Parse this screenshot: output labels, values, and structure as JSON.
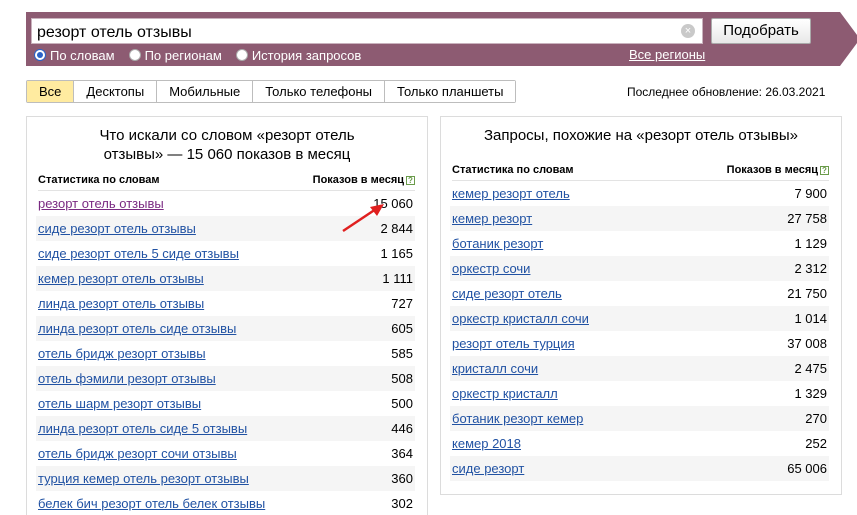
{
  "search": {
    "query": "резорт отель отзывы",
    "clear_glyph": "×",
    "submit_label": "Подобрать"
  },
  "modes": [
    {
      "label": "По словам",
      "selected": true
    },
    {
      "label": "По регионам",
      "selected": false
    },
    {
      "label": "История запросов",
      "selected": false
    }
  ],
  "regions_link": "Все регионы",
  "device_tabs": [
    {
      "label": "Все",
      "active": true
    },
    {
      "label": "Десктопы",
      "active": false
    },
    {
      "label": "Мобильные",
      "active": false
    },
    {
      "label": "Только телефоны",
      "active": false
    },
    {
      "label": "Только планшеты",
      "active": false
    }
  ],
  "last_update": "Последнее обновление: 26.03.2021",
  "left_panel": {
    "title_line1": "Что искали со словом «резорт отель",
    "title_line2": "отзывы» — 15 060 показов в месяц",
    "col_query": "Статистика по словам",
    "col_shows": "Показов в месяц",
    "help_glyph": "?",
    "rows": [
      {
        "query": "резорт отель отзывы",
        "shows": "15 060"
      },
      {
        "query": "сиде резорт отель отзывы",
        "shows": "2 844"
      },
      {
        "query": "сиде резорт отель 5 сиде отзывы",
        "shows": "1 165"
      },
      {
        "query": "кемер резорт отель отзывы",
        "shows": "1 111"
      },
      {
        "query": "линда резорт отель отзывы",
        "shows": "727"
      },
      {
        "query": "линда резорт отель сиде отзывы",
        "shows": "605"
      },
      {
        "query": "отель бридж резорт отзывы",
        "shows": "585"
      },
      {
        "query": "отель фэмили резорт отзывы",
        "shows": "508"
      },
      {
        "query": "отель шарм резорт отзывы",
        "shows": "500"
      },
      {
        "query": "линда резорт отель сиде 5 отзывы",
        "shows": "446"
      },
      {
        "query": "отель бридж резорт сочи отзывы",
        "shows": "364"
      },
      {
        "query": "турция кемер отель резорт отзывы",
        "shows": "360"
      },
      {
        "query": "белек бич резорт отель белек отзывы",
        "shows": "302"
      }
    ]
  },
  "right_panel": {
    "title": "Запросы, похожие на «резорт отель отзывы»",
    "col_query": "Статистика по словам",
    "col_shows": "Показов в месяц",
    "help_glyph": "?",
    "rows": [
      {
        "query": "кемер резорт отель",
        "shows": "7 900"
      },
      {
        "query": "кемер резорт",
        "shows": "27 758"
      },
      {
        "query": "ботаник резорт",
        "shows": "1 129"
      },
      {
        "query": "оркестр сочи",
        "shows": "2 312"
      },
      {
        "query": "сиде резорт отель",
        "shows": "21 750"
      },
      {
        "query": "оркестр кристалл сочи",
        "shows": "1 014"
      },
      {
        "query": "резорт отель турция",
        "shows": "37 008"
      },
      {
        "query": "кристалл сочи",
        "shows": "2 475"
      },
      {
        "query": "оркестр кристалл",
        "shows": "1 329"
      },
      {
        "query": "ботаник резорт кемер",
        "shows": "270"
      },
      {
        "query": "кемер 2018",
        "shows": "252"
      },
      {
        "query": "сиде резорт",
        "shows": "65 006"
      }
    ]
  },
  "colors": {
    "bar": "#8d5b72",
    "link": "#2152a3",
    "visited": "#7a2a82",
    "annotation_arrow": "#e0201f",
    "active_tab": "#ffeba0"
  }
}
